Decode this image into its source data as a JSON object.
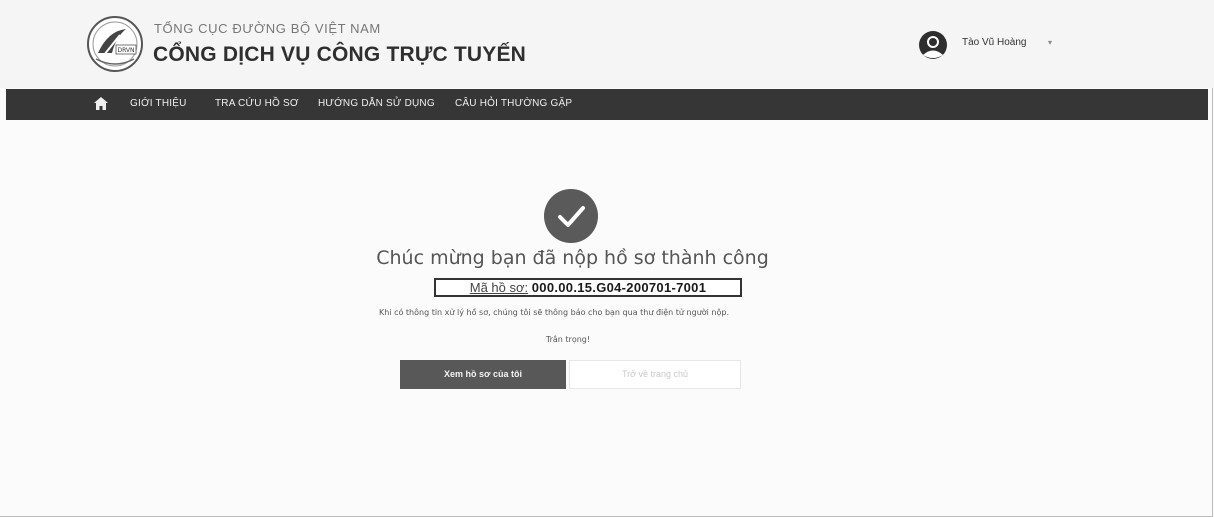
{
  "header": {
    "org_name": "TỔNG CỤC ĐƯỜNG BỘ VIỆT NAM",
    "portal_title": "CỔNG DỊCH VỤ CÔNG TRỰC TUYẾN",
    "logo_text": "DRVN",
    "user_name": "Tào Vũ Hoàng",
    "user_caret": "▾"
  },
  "nav": {
    "home_icon": "home-icon",
    "items": [
      {
        "label": "GIỚI THIỆU"
      },
      {
        "label": "TRA CỨU HỒ SƠ"
      },
      {
        "label": "HƯỚNG DẪN SỬ DỤNG"
      },
      {
        "label": "CÂU HỎI THƯỜNG GẶP"
      }
    ]
  },
  "main": {
    "success_icon": "check-circle-icon",
    "title": "Chúc mừng bạn đã nộp hồ sơ thành công",
    "case_label": "Mã hồ sơ:",
    "case_number": "000.00.15.G04-200701-7001",
    "notice": "Khi có thông tin xử lý hồ sơ, chúng tôi sẽ thông báo cho bạn qua thư điện tử người nộp.",
    "regards": "Trân trọng!",
    "primary_button": "Xem hồ sơ của tôi",
    "secondary_button": "Trở về trang chủ"
  },
  "colors": {
    "navbar": "#363636",
    "primary_button": "#585858",
    "success_icon": "#5a5a5a"
  }
}
